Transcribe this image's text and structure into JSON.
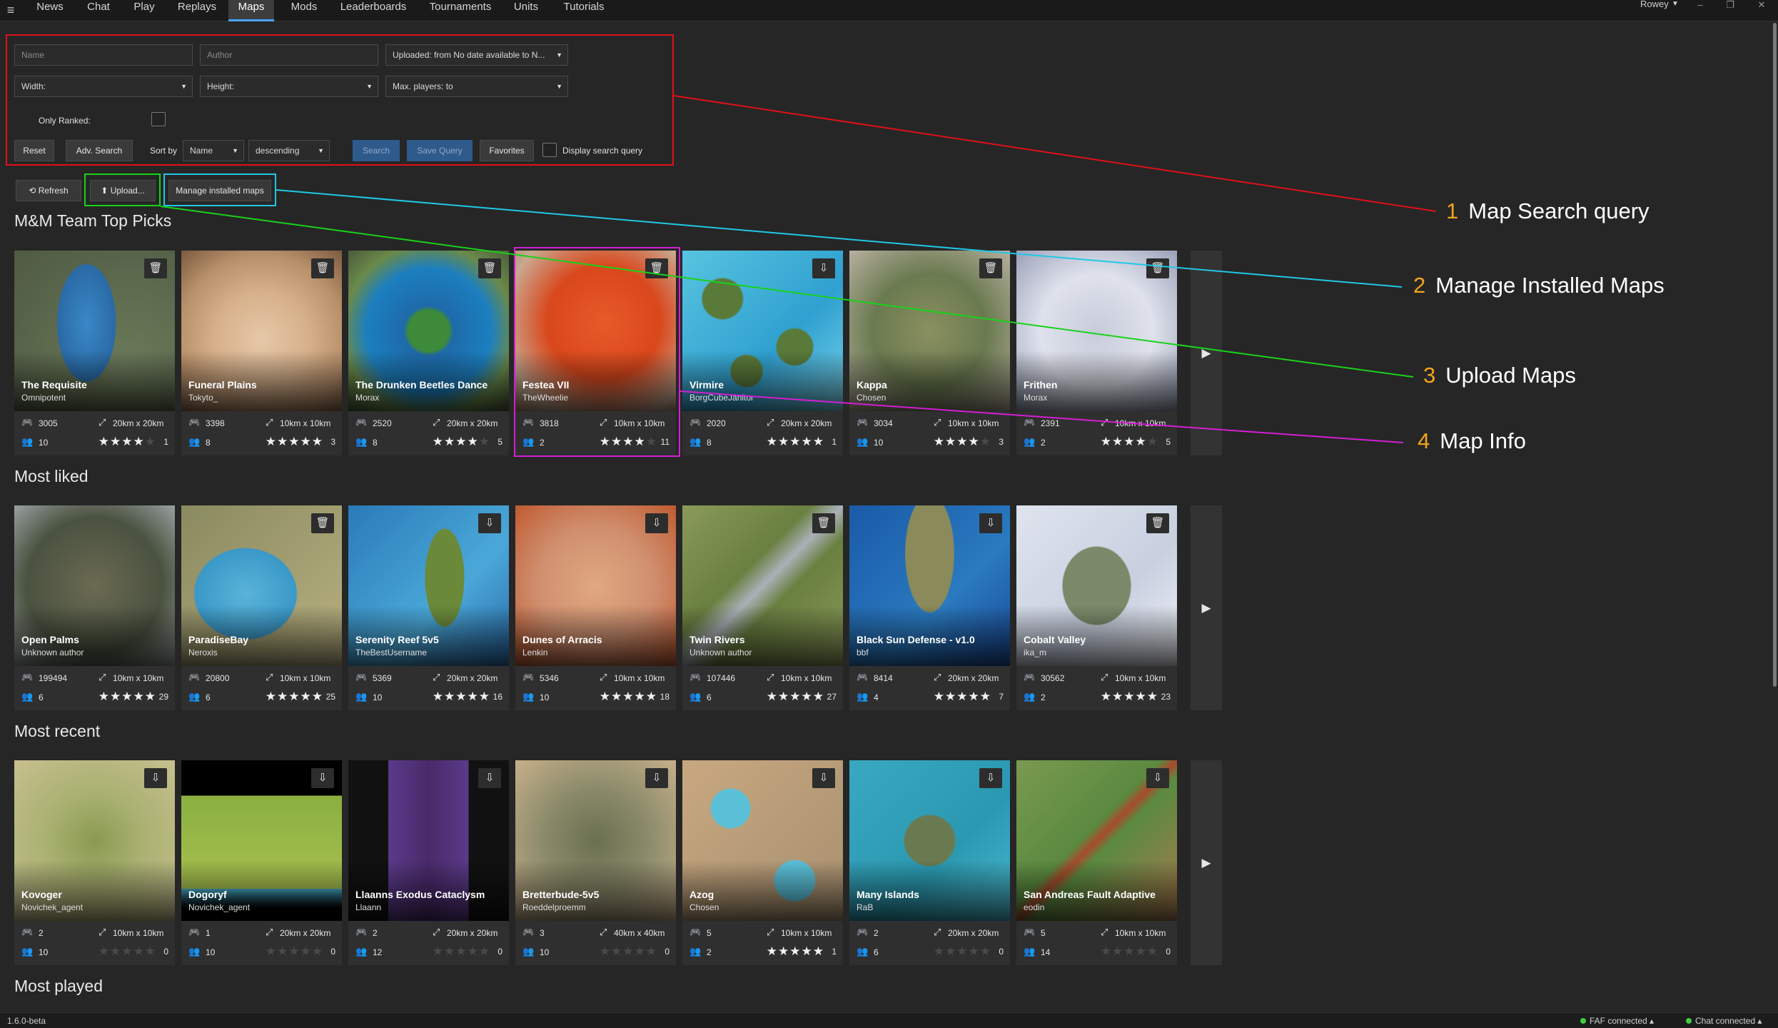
{
  "topbar": {
    "tabs": [
      "News",
      "Chat",
      "Play",
      "Replays",
      "Maps",
      "Mods",
      "Leaderboards",
      "Tournaments",
      "Units",
      "Tutorials"
    ],
    "active_tab": "Maps",
    "user": "Rowey",
    "window_buttons": [
      "–",
      "❐",
      "✕"
    ]
  },
  "search": {
    "name_placeholder": "Name",
    "author_placeholder": "Author",
    "uploaded": "Uploaded: from No date available to N...",
    "width": "Width:",
    "height": "Height:",
    "max_players": "Max. players:  to",
    "only_ranked": "Only Ranked:",
    "reset": "Reset",
    "adv_search": "Adv. Search",
    "sort_by": "Sort by",
    "sort_field": "Name",
    "sort_order": "descending",
    "search_button": "Search",
    "save_query": "Save Query",
    "favorites": "Favorites",
    "display_query": "Display search query"
  },
  "actions": {
    "refresh": "Refresh",
    "upload": "Upload...",
    "manage": "Manage installed maps"
  },
  "sections": [
    {
      "title": "M&M Team Top Picks",
      "maps": [
        {
          "name": "The Requisite",
          "author": "Omnipotent",
          "plays": "3005",
          "size": "20km x 20km",
          "players": "10",
          "rating": 4,
          "reviews": "1",
          "action": "delete",
          "palette": "requisite"
        },
        {
          "name": "Funeral Plains",
          "author": "Tokyto_",
          "plays": "3398",
          "size": "10km x 10km",
          "players": "8",
          "rating": 5,
          "reviews": "3",
          "action": "delete",
          "palette": "funeral"
        },
        {
          "name": "The Drunken Beetles Dance",
          "author": "Morax",
          "plays": "2520",
          "size": "20km x 20km",
          "players": "8",
          "rating": 3.5,
          "reviews": "5",
          "action": "delete",
          "palette": "beetles"
        },
        {
          "name": "Festea VII",
          "author": "TheWheelie",
          "plays": "3818",
          "size": "10km x 10km",
          "players": "2",
          "rating": 4,
          "reviews": "11",
          "action": "delete",
          "palette": "festea"
        },
        {
          "name": "Virmire",
          "author": "BorgCubeJanitor",
          "plays": "2020",
          "size": "20km x 20km",
          "players": "8",
          "rating": 5,
          "reviews": "1",
          "action": "download",
          "palette": "virmire"
        },
        {
          "name": "Kappa",
          "author": "Chosen",
          "plays": "3034",
          "size": "10km x 10km",
          "players": "10",
          "rating": 3.5,
          "reviews": "3",
          "action": "delete",
          "palette": "kappa"
        },
        {
          "name": "Frithen",
          "author": "Morax",
          "plays": "2391",
          "size": "10km x 10km",
          "players": "2",
          "rating": 3.5,
          "reviews": "5",
          "action": "delete",
          "palette": "frithen"
        }
      ]
    },
    {
      "title": "Most liked",
      "maps": [
        {
          "name": "Open Palms",
          "author": "Unknown author",
          "plays": "199494",
          "size": "10km x 10km",
          "players": "6",
          "rating": 4.5,
          "reviews": "29",
          "action": "none",
          "palette": "openpalms"
        },
        {
          "name": "ParadiseBay",
          "author": "Neroxis",
          "plays": "20800",
          "size": "10km x 10km",
          "players": "6",
          "rating": 4.5,
          "reviews": "25",
          "action": "delete",
          "palette": "paradise"
        },
        {
          "name": "Serenity Reef 5v5",
          "author": "TheBestUsername",
          "plays": "5369",
          "size": "20km x 20km",
          "players": "10",
          "rating": 5,
          "reviews": "16",
          "action": "download",
          "palette": "serenity"
        },
        {
          "name": "Dunes of Arracis",
          "author": "Lenkin",
          "plays": "5346",
          "size": "10km x 10km",
          "players": "10",
          "rating": 5,
          "reviews": "18",
          "action": "download",
          "palette": "dunes"
        },
        {
          "name": "Twin Rivers",
          "author": "Unknown author",
          "plays": "107446",
          "size": "10km x 10km",
          "players": "6",
          "rating": 4.5,
          "reviews": "27",
          "action": "delete",
          "palette": "twin"
        },
        {
          "name": "Black Sun Defense - v1.0",
          "author": "bbf",
          "plays": "8414",
          "size": "20km x 20km",
          "players": "4",
          "rating": 5,
          "reviews": "7",
          "action": "download",
          "palette": "blacksun"
        },
        {
          "name": "Cobalt Valley",
          "author": "ika_m",
          "plays": "30562",
          "size": "10km x 10km",
          "players": "2",
          "rating": 4.5,
          "reviews": "23",
          "action": "delete",
          "palette": "cobalt"
        }
      ]
    },
    {
      "title": "Most recent",
      "maps": [
        {
          "name": "Kovoger",
          "author": "Novichek_agent",
          "plays": "2",
          "size": "10km x 10km",
          "players": "10",
          "rating": 0,
          "reviews": "0",
          "action": "download",
          "palette": "kovoger"
        },
        {
          "name": "Dogoryf",
          "author": "Novichek_agent",
          "plays": "1",
          "size": "20km x 20km",
          "players": "10",
          "rating": 0,
          "reviews": "0",
          "action": "download",
          "palette": "dogoryf"
        },
        {
          "name": "Llaanns Exodus Cataclysm",
          "author": "Llaann",
          "plays": "2",
          "size": "20km x 20km",
          "players": "12",
          "rating": 0,
          "reviews": "0",
          "action": "download",
          "palette": "exodus"
        },
        {
          "name": "Bretterbude-5v5",
          "author": "Roeddelproemm",
          "plays": "3",
          "size": "40km x 40km",
          "players": "10",
          "rating": 0,
          "reviews": "0",
          "action": "download",
          "palette": "bretter"
        },
        {
          "name": "Azog",
          "author": "Chosen",
          "plays": "5",
          "size": "10km x 10km",
          "players": "2",
          "rating": 5,
          "reviews": "1",
          "action": "download",
          "palette": "azog"
        },
        {
          "name": "Many Islands",
          "author": "RaB",
          "plays": "2",
          "size": "20km x 20km",
          "players": "6",
          "rating": 0,
          "reviews": "0",
          "action": "download",
          "palette": "manyislands"
        },
        {
          "name": "San Andreas Fault Adaptive",
          "author": "eodin",
          "plays": "5",
          "size": "10km x 10km",
          "players": "14",
          "rating": 0,
          "reviews": "0",
          "action": "download",
          "palette": "sanandreas"
        }
      ]
    },
    {
      "title": "Most played",
      "maps": []
    }
  ],
  "callouts": [
    {
      "num": "1",
      "label": "Map Search query",
      "color": "#e0101a"
    },
    {
      "num": "2",
      "label": "Manage Installed Maps",
      "color": "#1fc8e6"
    },
    {
      "num": "3",
      "label": "Upload Maps",
      "color": "#19d219"
    },
    {
      "num": "4",
      "label": "Map Info",
      "color": "#d41ed4"
    }
  ],
  "status": {
    "version": "1.6.0-beta",
    "faf": "FAF connected",
    "chat": "Chat connected"
  },
  "colors": {
    "accent": "#4aa3ff",
    "callout_number": "#f2a51a"
  }
}
